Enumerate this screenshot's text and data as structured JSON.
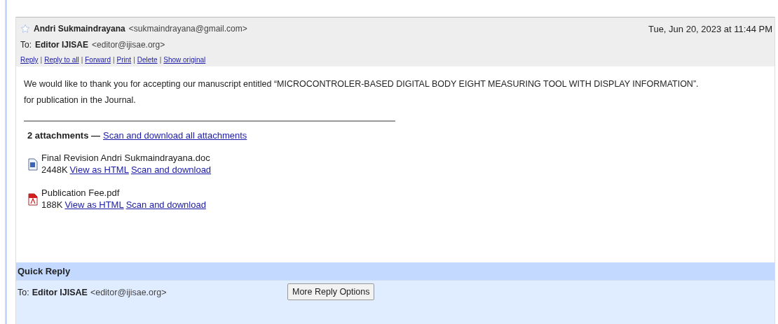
{
  "message": {
    "starred": false,
    "sender_name": "Andri Sukmaindrayana",
    "sender_email": "<sukmaindrayana@gmail.com>",
    "date": "Tue, Jun 20, 2023 at 11:44 PM",
    "to_label": "To:",
    "to_name": "Editor IJISAE",
    "to_email": "<editor@ijisae.org>",
    "actions": [
      "Reply",
      "Reply to all",
      "Forward",
      "Print",
      "Delete",
      "Show original"
    ],
    "action_separator": "|",
    "body": [
      "We would like to thank you for accepting our manuscript entitled “MICROCONTROLER-BASED DIGITAL BODY EIGHT MEASURING TOOL WITH DISPLAY INFORMATION”.",
      "for publication in the Journal."
    ]
  },
  "attachments": {
    "summary": "2 attachments —",
    "download_all": "Scan and download all attachments",
    "items": [
      {
        "kind": "doc",
        "name": "Final Revision Andri Sukmaindrayana.doc",
        "size": "2448K",
        "links": [
          "View as HTML",
          "Scan and download"
        ]
      },
      {
        "kind": "pdf",
        "name": "Publication Fee.pdf",
        "size": "188K",
        "links": [
          "View as HTML",
          "Scan and download"
        ]
      }
    ]
  },
  "quick_reply": {
    "title": "Quick Reply",
    "to_label": "To:",
    "to_name": "Editor IJISAE",
    "to_email": "<editor@ijisae.org>",
    "button": "More Reply Options"
  }
}
